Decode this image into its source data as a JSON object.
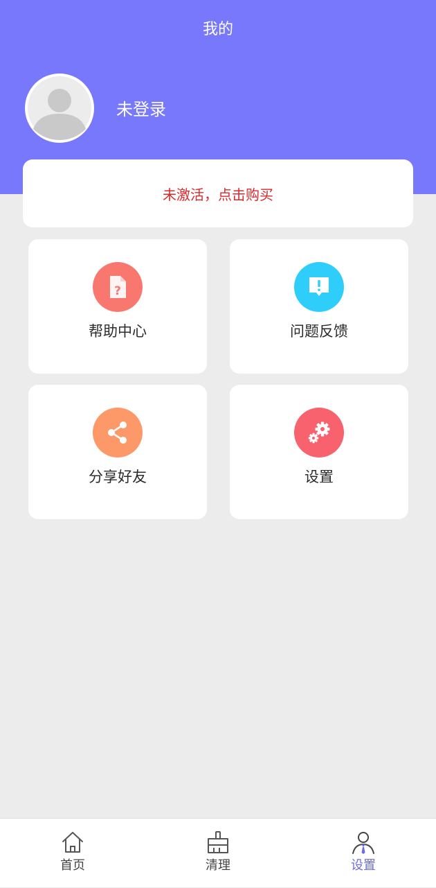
{
  "header": {
    "title": "我的",
    "background_color": "#7878fd"
  },
  "user": {
    "name": "未登录",
    "avatar_icon": "default-avatar-icon"
  },
  "activation": {
    "text": "未激活，点击购买",
    "text_color": "#d9292b"
  },
  "menu": [
    {
      "label": "帮助中心",
      "icon": "help-document-icon",
      "color": "#f87870"
    },
    {
      "label": "问题反馈",
      "icon": "feedback-message-icon",
      "color": "#2ecdfa"
    },
    {
      "label": "分享好友",
      "icon": "share-icon",
      "color": "#fd9868"
    },
    {
      "label": "设置",
      "icon": "gears-icon",
      "color": "#f8626e"
    }
  ],
  "tabs": [
    {
      "label": "首页",
      "icon": "home-icon",
      "active": false
    },
    {
      "label": "清理",
      "icon": "broom-icon",
      "active": false
    },
    {
      "label": "设置",
      "icon": "user-profile-icon",
      "active": true
    }
  ],
  "accent_color": "#6d6de0"
}
